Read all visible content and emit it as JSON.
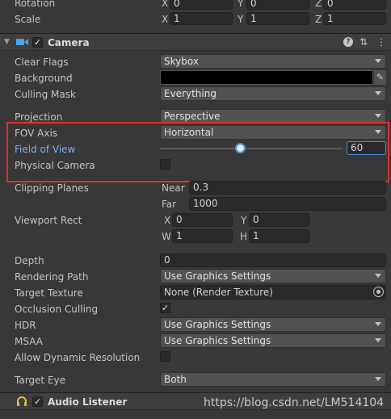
{
  "transform": {
    "rotation_label": "Rotation",
    "rotation": {
      "x_label": "X",
      "x": "0",
      "y_label": "Y",
      "y": "0",
      "z_label": "Z",
      "z": "0"
    },
    "scale_label": "Scale",
    "scale": {
      "x_label": "X",
      "x": "1",
      "y_label": "Y",
      "y": "1",
      "z_label": "Z",
      "z": "1"
    }
  },
  "camera": {
    "title": "Camera",
    "enabled_check": "✓",
    "help_icon": "?",
    "preset_icon": "⇅",
    "menu_icon": "⋮",
    "clear_flags": {
      "label": "Clear Flags",
      "value": "Skybox"
    },
    "background": {
      "label": "Background",
      "color": "#000000"
    },
    "culling_mask": {
      "label": "Culling Mask",
      "value": "Everything"
    },
    "projection": {
      "label": "Projection",
      "value": "Perspective"
    },
    "fov_axis": {
      "label": "FOV Axis",
      "value": "Horizontal"
    },
    "field_of_view": {
      "label": "Field of View",
      "value": "60",
      "slider_fraction": 0.44
    },
    "physical_camera": {
      "label": "Physical Camera",
      "checked": false
    },
    "clipping_planes": {
      "label": "Clipping Planes",
      "near_label": "Near",
      "near": "0.3",
      "far_label": "Far",
      "far": "1000"
    },
    "viewport_rect": {
      "label": "Viewport Rect",
      "x_label": "X",
      "x": "0",
      "y_label": "Y",
      "y": "0",
      "w_label": "W",
      "w": "1",
      "h_label": "H",
      "h": "1"
    },
    "depth": {
      "label": "Depth",
      "value": "0"
    },
    "rendering_path": {
      "label": "Rendering Path",
      "value": "Use Graphics Settings"
    },
    "target_texture": {
      "label": "Target Texture",
      "value": "None (Render Texture)"
    },
    "occlusion_culling": {
      "label": "Occlusion Culling",
      "check": "✓"
    },
    "hdr": {
      "label": "HDR",
      "value": "Use Graphics Settings"
    },
    "msaa": {
      "label": "MSAA",
      "value": "Use Graphics Settings"
    },
    "allow_dynamic_resolution": {
      "label": "Allow Dynamic Resolution",
      "checked": false
    },
    "target_eye": {
      "label": "Target Eye",
      "value": "Both"
    }
  },
  "audio_listener": {
    "title": "Audio Listener",
    "enabled_check": "✓"
  },
  "watermark": "https://blog.csdn.net/LM514104",
  "colors": {
    "highlight_border": "#e0302a",
    "accent_blue": "#7fb0f0",
    "slider_focus": "#4a8de0"
  }
}
